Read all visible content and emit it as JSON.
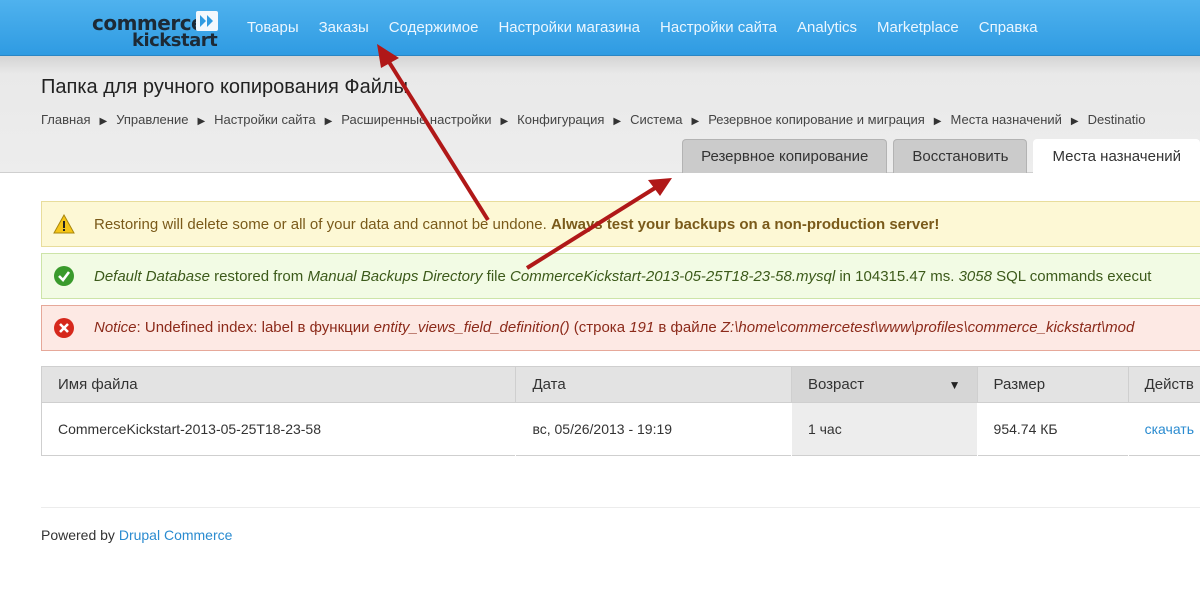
{
  "brand": {
    "line1": "commerce",
    "line2": "kickstart"
  },
  "nav": [
    "Товары",
    "Заказы",
    "Содержимое",
    "Настройки магазина",
    "Настройки сайта",
    "Analytics",
    "Marketplace",
    "Справка"
  ],
  "page_title": "Папка для ручного копирования Файлы",
  "breadcrumb": [
    "Главная",
    "Управление",
    "Настройки сайта",
    "Расширенные настройки",
    "Конфигурация",
    "Система",
    "Резервное копирование и миграция",
    "Места назначений",
    "Destinatio"
  ],
  "tabs": [
    "Резервное копирование",
    "Восстановить",
    "Места назначений"
  ],
  "messages": {
    "warning": {
      "text": "Restoring will delete some or all of your data and cannot be undone. ",
      "strong": "Always test your backups on a non-production server!"
    },
    "status": {
      "db": "Default Database",
      "t1": " restored from ",
      "src": "Manual Backups Directory",
      "t2": " file ",
      "file": "CommerceKickstart-2013-05-25T18-23-58.mysql",
      "t3": " in 104315.47 ms. ",
      "count": "3058",
      "t4": " SQL commands execut"
    },
    "error": {
      "notice": "Notice",
      "t1": ": Undefined index: label в функции ",
      "fn": "entity_views_field_definition()",
      "t2": " (строка ",
      "line": "191",
      "t3": " в файле ",
      "path": "Z:\\home\\commercetest\\www\\profiles\\commerce_kickstart\\mod"
    }
  },
  "table": {
    "headers": [
      "Имя файла",
      "Дата",
      "Возраст",
      "Размер",
      "Действ"
    ],
    "row": [
      "CommerceKickstart-2013-05-25T18-23-58",
      "вс, 05/26/2013 - 19:19",
      "1 час",
      "954.74 КБ",
      "скачать"
    ]
  },
  "footer": {
    "prefix": "Powered by ",
    "link": "Drupal Commerce"
  },
  "colors": {
    "nav_bg": "#3aa4e8",
    "link": "#2a8bd0",
    "arrow": "#b01818"
  }
}
